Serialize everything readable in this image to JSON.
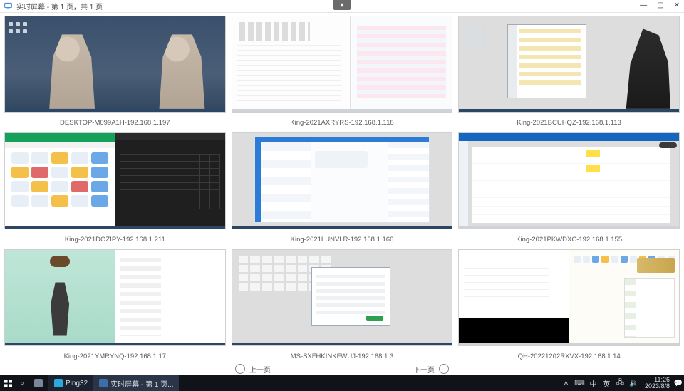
{
  "window": {
    "title": "实时屏幕 - 第 1 页，共 1 页",
    "dropdown_glyph": "▾",
    "controls": {
      "min": "—",
      "max": "▢",
      "close": "✕"
    }
  },
  "thumbs": [
    {
      "label": "DESKTOP-M099A1H-192.168.1.197"
    },
    {
      "label": "King-2021AXRYRS-192.168.1.118"
    },
    {
      "label": "King-2021BCUHQZ-192.168.1.113"
    },
    {
      "label": "King-2021DOZIPY-192.168.1.211"
    },
    {
      "label": "King-2021LUNVLR-192.168.1.166"
    },
    {
      "label": "King-2021PKWDXC-192.168.1.155"
    },
    {
      "label": "King-2021YMRYNQ-192.168.1.17"
    },
    {
      "label": "MS-SXFHKINKFWUJ-192.168.1.3"
    },
    {
      "label": "QH-20221202RXVX-192.168.1.14"
    }
  ],
  "pager": {
    "prev_glyph": "←",
    "prev_label": "上一页",
    "next_label": "下一页",
    "next_glyph": "→"
  },
  "taskbar": {
    "search_glyph": "⌕",
    "app1": {
      "label": "Ping32",
      "color": "#2aa8e0"
    },
    "app2": {
      "label": "实时屏幕 - 第 1 页...",
      "color": "#3d6ea8"
    },
    "tray": {
      "up": "˄",
      "ime1": "⌨",
      "ime2": "中",
      "ime3": "英",
      "net": "🖧",
      "vol": "🔉"
    },
    "clock": {
      "time": "11:26",
      "date": "2023/8/8"
    },
    "notif_glyph": "💬"
  }
}
